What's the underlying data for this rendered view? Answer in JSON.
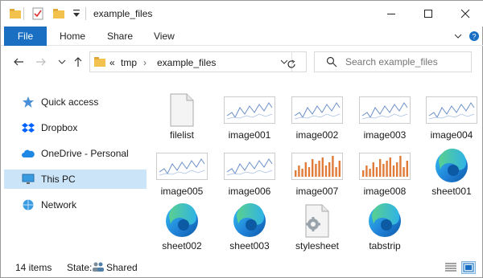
{
  "window": {
    "title": "example_files"
  },
  "ribbon": {
    "file_tab": "File",
    "tabs": [
      "Home",
      "Share",
      "View"
    ]
  },
  "address": {
    "overflow": "«",
    "crumbs": [
      "tmp",
      "example_files"
    ]
  },
  "search": {
    "placeholder": "Search example_files"
  },
  "sidebar": {
    "items": [
      {
        "label": "Quick access",
        "icon": "star-icon"
      },
      {
        "label": "Dropbox",
        "icon": "dropbox-icon"
      },
      {
        "label": "OneDrive - Personal",
        "icon": "cloud-icon"
      },
      {
        "label": "This PC",
        "icon": "computer-icon",
        "selected": true
      },
      {
        "label": "Network",
        "icon": "network-icon"
      }
    ]
  },
  "files": [
    {
      "name": "filelist",
      "type": "document"
    },
    {
      "name": "image001",
      "type": "line-chart"
    },
    {
      "name": "image002",
      "type": "line-chart"
    },
    {
      "name": "image003",
      "type": "line-chart"
    },
    {
      "name": "image004",
      "type": "line-chart"
    },
    {
      "name": "image005",
      "type": "line-chart"
    },
    {
      "name": "image006",
      "type": "line-chart"
    },
    {
      "name": "image007",
      "type": "bar-chart"
    },
    {
      "name": "image008",
      "type": "bar-chart"
    },
    {
      "name": "sheet001",
      "type": "edge"
    },
    {
      "name": "sheet002",
      "type": "edge"
    },
    {
      "name": "sheet003",
      "type": "edge"
    },
    {
      "name": "stylesheet",
      "type": "settings-document"
    },
    {
      "name": "tabstrip",
      "type": "edge"
    }
  ],
  "status": {
    "item_count": "14 items",
    "state_label": "State:",
    "state_value": "Shared"
  },
  "colors": {
    "accent": "#1a6fc2",
    "selection": "#cce4f7",
    "folder": "#f2c14e"
  }
}
